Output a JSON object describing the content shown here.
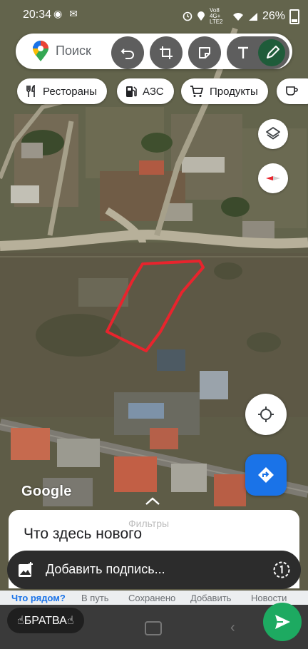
{
  "status_bar": {
    "time": "20:34",
    "notif_icons": "◉ ✉",
    "network": "Vo8 4G+ LTE2",
    "battery": "26%"
  },
  "search": {
    "placeholder": "Поиск"
  },
  "chips": [
    {
      "label": "Рестораны",
      "icon": "restaurant-icon"
    },
    {
      "label": "АЗС",
      "icon": "gas-station-icon"
    },
    {
      "label": "Продукты",
      "icon": "cart-icon"
    }
  ],
  "map": {
    "attribution": "Google"
  },
  "sheet": {
    "filters_label": "Фильтры",
    "title": "Что здесь нового"
  },
  "caption": {
    "placeholder": "Добавить подпись..."
  },
  "nav_tabs": [
    {
      "label": "Что рядом?"
    },
    {
      "label": "В путь"
    },
    {
      "label": "Сохранено"
    },
    {
      "label": "Добавить"
    },
    {
      "label": "Новости"
    }
  ],
  "recipient": {
    "name": "☝БРАТВА☝"
  },
  "colors": {
    "accent": "#1a73e8",
    "send": "#1daa61",
    "highlight": "#e8242d"
  }
}
